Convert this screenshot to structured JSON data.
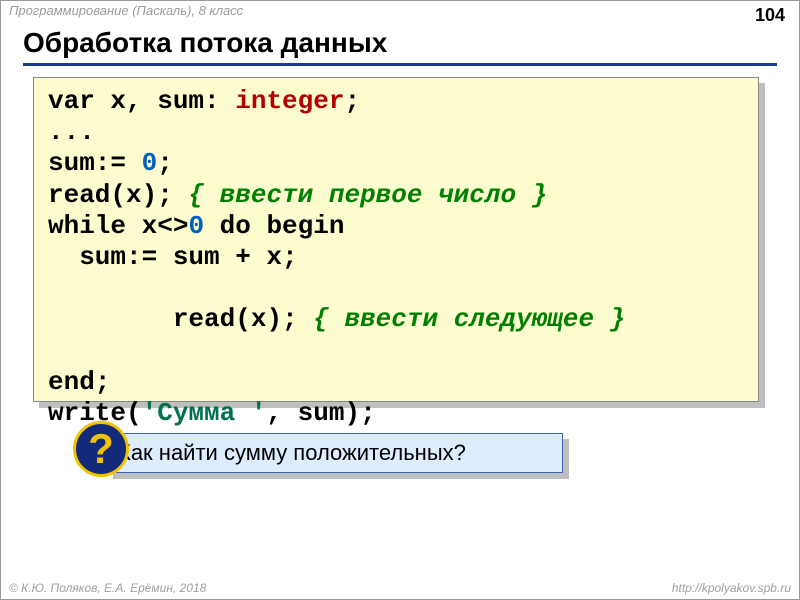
{
  "header": {
    "breadcrumb": "Программирование (Паскаль), 8 класс",
    "page_number": "104"
  },
  "title": "Обработка потока данных",
  "code": {
    "l1_pre": "var x, sum: ",
    "l1_type": "integer",
    "l1_post": ";",
    "l2": "...",
    "l3_a": "sum:= ",
    "l3_num": "0",
    "l3_b": ";",
    "l4_a": "read(x); ",
    "l4_cmt": "{ ввести первое число }",
    "l5_a": "while x<>",
    "l5_num": "0",
    "l5_b": " do begin",
    "l6": "  sum:= sum + x;",
    "l7_a": "  read(x); ",
    "l7_cmt": "{ ввести следующее }",
    "l8": "end;",
    "l9_a": "write(",
    "l9_str": "'Сумма '",
    "l9_b": ", sum);"
  },
  "question": {
    "badge": "?",
    "text": "Как найти сумму положительных?"
  },
  "footer": {
    "left": "© К.Ю. Поляков, Е.А. Ерёмин, 2018",
    "right": "http://kpolyakov.spb.ru"
  }
}
